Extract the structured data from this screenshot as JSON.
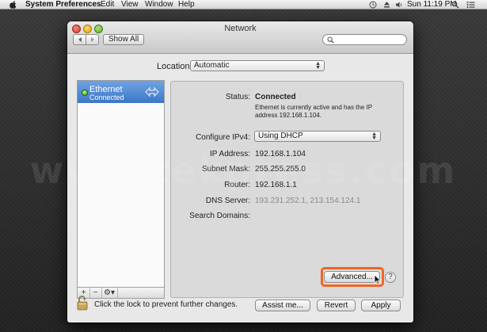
{
  "menubar": {
    "app_name": "System Preferences",
    "menus": [
      "Edit",
      "View",
      "Window",
      "Help"
    ],
    "clock": "Sun 11:19 PM",
    "status_icons": [
      "time-machine-icon",
      "eject-icon",
      "volume-icon",
      "spotlight-icon",
      "notification-list-icon"
    ]
  },
  "watermark": "www.tekpress.com",
  "window": {
    "title": "Network",
    "toolbar": {
      "show_all_label": "Show All"
    },
    "location": {
      "label": "Location:",
      "value": "Automatic"
    }
  },
  "sidebar": {
    "services": [
      {
        "name": "Ethernet",
        "status": "Connected",
        "status_color": "#36a11d",
        "selected": true
      }
    ],
    "footer": {
      "add_label": "+",
      "remove_label": "−",
      "action_label": "⚙▾"
    }
  },
  "detail": {
    "status": {
      "label": "Status:",
      "value": "Connected",
      "description": "Ethernet is currently active and has the IP address 192.168.1.104."
    },
    "configure_ipv4": {
      "label": "Configure IPv4:",
      "value": "Using DHCP"
    },
    "ip_address": {
      "label": "IP Address:",
      "value": "192.168.1.104"
    },
    "subnet_mask": {
      "label": "Subnet Mask:",
      "value": "255.255.255.0"
    },
    "router": {
      "label": "Router:",
      "value": "192.168.1.1"
    },
    "dns_server": {
      "label": "DNS Server:",
      "value": "193.231.252.1, 213.154.124.1"
    },
    "search_domains": {
      "label": "Search Domains:"
    },
    "advanced_label": "Advanced...",
    "help_label": "?"
  },
  "bottom": {
    "lock_text": "Click the lock to prevent further changes.",
    "assist_label": "Assist me...",
    "revert_label": "Revert",
    "apply_label": "Apply"
  },
  "colors": {
    "highlight": "#f26522",
    "selection": "#3c77c8",
    "desktop": "#2b2b2b"
  }
}
